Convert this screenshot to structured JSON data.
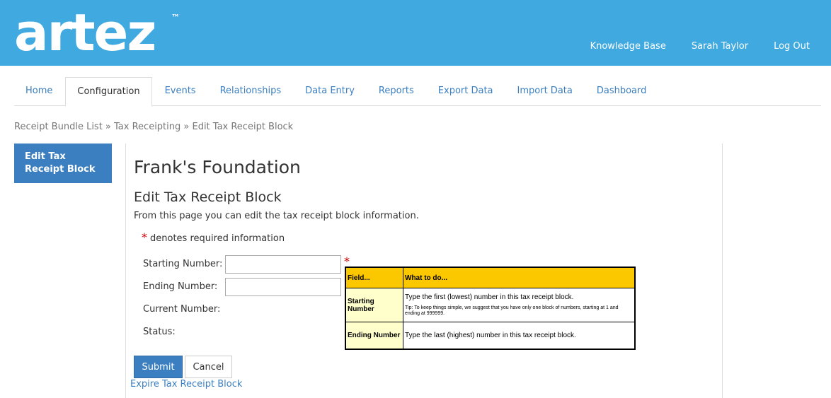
{
  "header": {
    "logo_text": "artez",
    "logo_tm": "™",
    "links": [
      "Knowledge Base",
      "Sarah Taylor",
      "Log Out"
    ],
    "bg_color": "#3fa9e0"
  },
  "tabs": [
    "Home",
    "Configuration",
    "Events",
    "Relationships",
    "Data Entry",
    "Reports",
    "Export Data",
    "Import Data",
    "Dashboard"
  ],
  "active_tab": "Configuration",
  "breadcrumb": "Receipt Bundle List » Tax Receipting » Edit Tax Receipt Block",
  "sidebar": {
    "button_label": "Edit Tax Receipt Block"
  },
  "main": {
    "org_title": "Frank's Foundation",
    "sub_title": "Edit Tax Receipt Block",
    "description": "From this page you can edit the tax receipt block information.",
    "required_star": "*",
    "required_note": "denotes required information",
    "fields": {
      "starting_label": "Starting Number:",
      "ending_label": "Ending Number:",
      "current_label": "Current Number:",
      "status_label": "Status:",
      "starting_value": "",
      "ending_value": ""
    },
    "help": {
      "col_field": "Field...",
      "col_todo": "What to do...",
      "row1_field": "Starting Number",
      "row1_text": "Type the first (lowest) number in this tax receipt block.",
      "row1_tip": "Tip: To keep things simple, we suggest that you have only one block of numbers, starting at 1 and ending at 999999.",
      "row2_field": "Ending Number",
      "row2_text": "Type the last (highest) number in this tax receipt block."
    },
    "submit_label": "Submit",
    "cancel_label": "Cancel",
    "expire_link": "Expire Tax Receipt Block"
  }
}
